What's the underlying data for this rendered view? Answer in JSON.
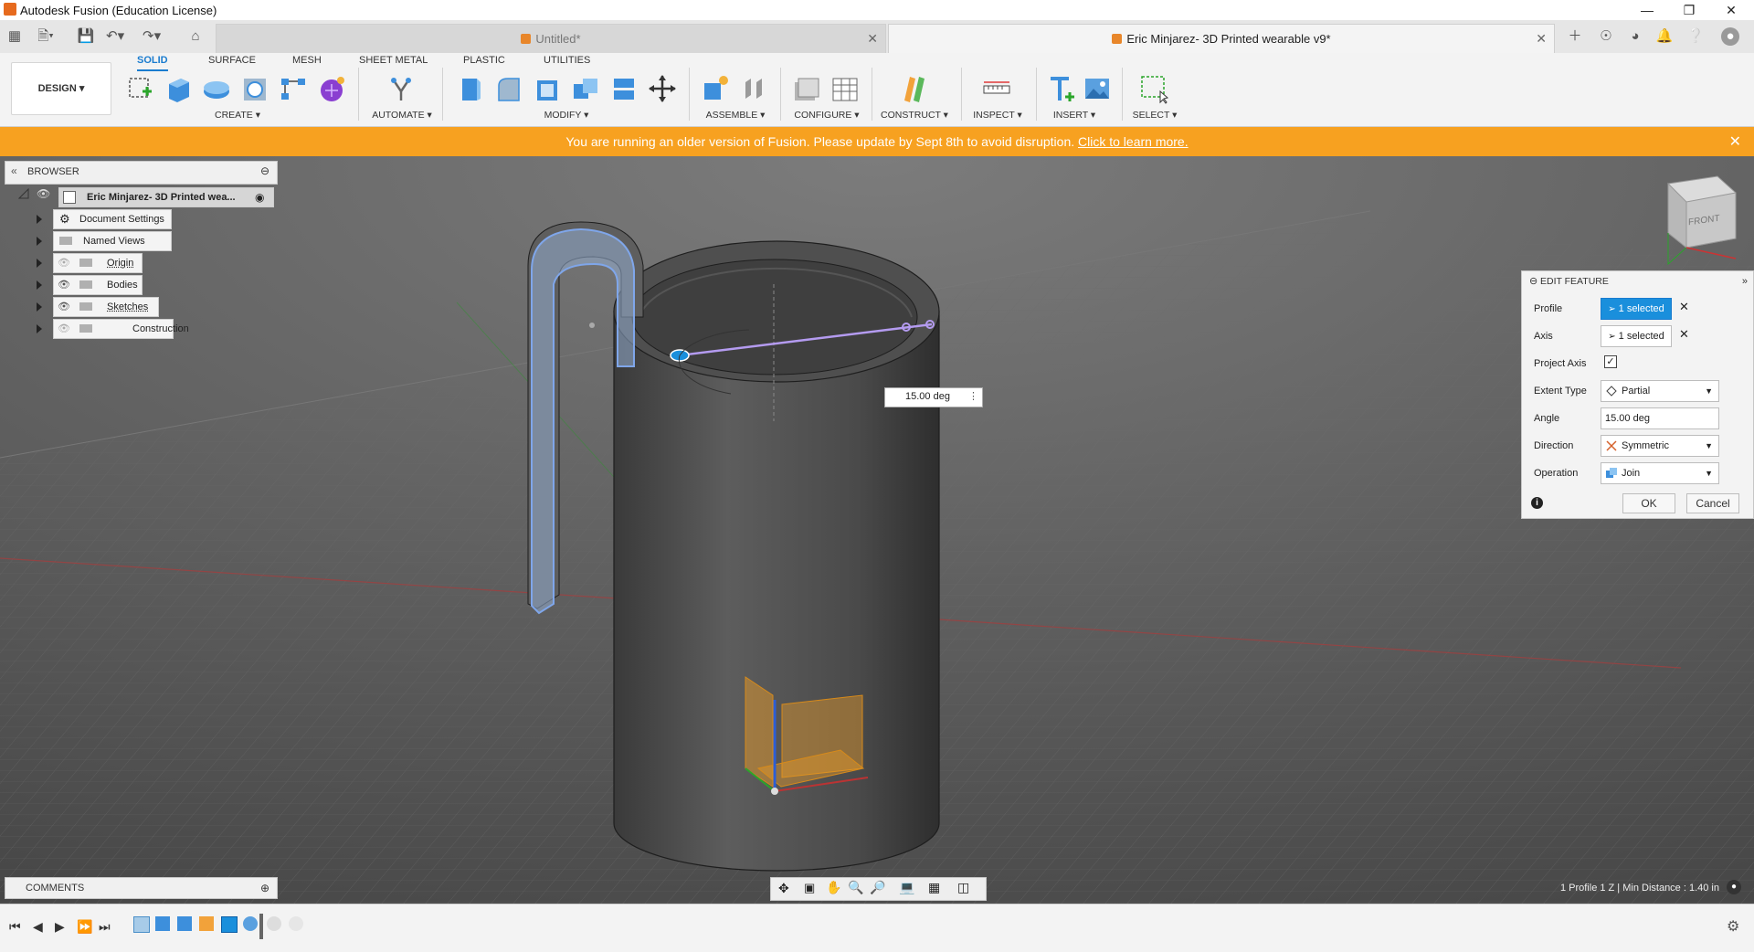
{
  "window": {
    "title": "Autodesk Fusion (Education License)"
  },
  "tabs": [
    {
      "label": "Untitled*",
      "active": false
    },
    {
      "label": "Eric Minjarez- 3D Printed wearable v9*",
      "active": true
    }
  ],
  "ribbon": {
    "workspace": "DESIGN ▾",
    "tabs": [
      "SOLID",
      "SURFACE",
      "MESH",
      "SHEET METAL",
      "PLASTIC",
      "UTILITIES"
    ],
    "groups": {
      "create": "CREATE ▾",
      "automate": "AUTOMATE ▾",
      "modify": "MODIFY ▾",
      "assemble": "ASSEMBLE ▾",
      "configure": "CONFIGURE ▾",
      "construct": "CONSTRUCT ▾",
      "inspect": "INSPECT ▾",
      "insert": "INSERT ▾",
      "select": "SELECT ▾"
    }
  },
  "banner": {
    "message": "You are running an older version of Fusion. Please update by Sept 8th to avoid disruption.",
    "link": "Click to learn more."
  },
  "browser": {
    "title": "BROWSER",
    "root": "Eric Minjarez- 3D Printed wea...",
    "items": [
      "Document Settings",
      "Named Views",
      "Origin",
      "Bodies",
      "Sketches",
      "Construction"
    ]
  },
  "viewcube": {
    "face": "FRONT"
  },
  "angle_input": "15.00 deg",
  "edit_feature": {
    "title": "EDIT FEATURE",
    "profile_label": "Profile",
    "profile_value": "1 selected",
    "axis_label": "Axis",
    "axis_value": "1 selected",
    "project_axis_label": "Project Axis",
    "project_axis_checked": true,
    "extent_type_label": "Extent Type",
    "extent_type_value": "Partial",
    "angle_label": "Angle",
    "angle_value": "15.00 deg",
    "direction_label": "Direction",
    "direction_value": "Symmetric",
    "operation_label": "Operation",
    "operation_value": "Join",
    "ok": "OK",
    "cancel": "Cancel"
  },
  "comments": {
    "label": "COMMENTS"
  },
  "status": {
    "text": "1 Profile 1 Z | Min Distance : 1.40 in"
  },
  "colors": {
    "accent": "#1a8fdc",
    "banner": "#f7a120",
    "selection": "#9b7be0"
  }
}
